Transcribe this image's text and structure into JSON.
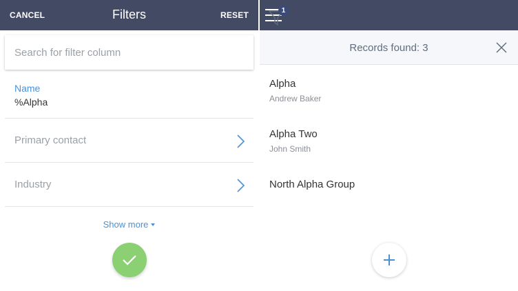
{
  "filters_panel": {
    "cancel_label": "CANCEL",
    "title": "Filters",
    "reset_label": "RESET",
    "search": {
      "placeholder": "Search for filter column",
      "value": ""
    },
    "name_filter": {
      "label": "Name",
      "value": "%Alpha"
    },
    "filter_rows": [
      {
        "label": "Primary contact",
        "icon": "chevron-right-icon"
      },
      {
        "label": "Industry",
        "icon": "chevron-right-icon"
      }
    ],
    "show_more_label": "Show more",
    "apply_icon": "checkmark-icon"
  },
  "records_panel": {
    "menu_icon": "hamburger-menu-icon",
    "filter_badge_count": "1",
    "records_found_text": "Records found: 3",
    "close_icon": "close-icon",
    "records": [
      {
        "title": "Alpha",
        "subtitle": "Andrew Baker"
      },
      {
        "title": "Alpha Two",
        "subtitle": "John Smith"
      },
      {
        "title": "North Alpha Group",
        "subtitle": ""
      }
    ],
    "add_icon": "plus-icon"
  },
  "colors": {
    "header": "#434b64",
    "accent_blue": "#4a90d9",
    "apply_green": "#8bd073",
    "badge": "#3c4a7a"
  }
}
